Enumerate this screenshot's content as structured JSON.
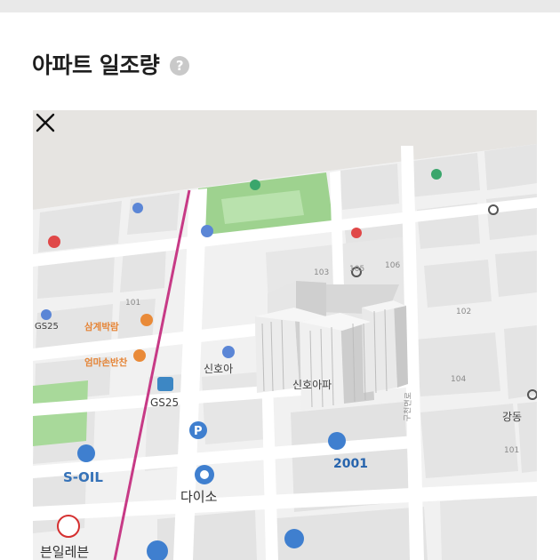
{
  "header": {
    "title": "아파트 일조량",
    "help_icon": "question-circle-icon",
    "help_glyph": "?"
  },
  "map": {
    "close_icon": "close-icon",
    "labels": {
      "s_oil": "S-OIL",
      "gs25_left": "GS25",
      "gs25_center": "GS25",
      "daiso": "다이소",
      "mark_2001": "2001",
      "seven_eleven": "븐일레븐",
      "sinhoapt": "신호아파",
      "sinhoapt_small": "신호아",
      "dongdong": "강동",
      "store1": "삼계박람",
      "store2": "엄마손반찬",
      "bldg_101": "101",
      "bldg_103": "103",
      "bldg_104": "104",
      "bldg_105": "105",
      "bldg_106": "106",
      "bldg_102": "102",
      "bldg_101b": "101",
      "road_mark": "구천면로"
    }
  }
}
